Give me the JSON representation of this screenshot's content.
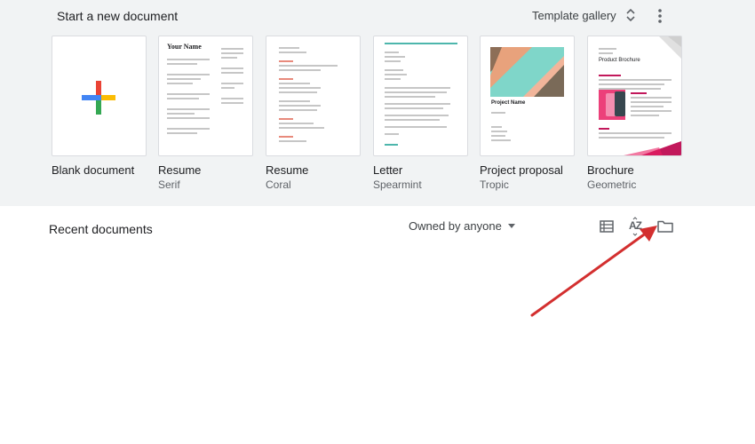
{
  "templates": {
    "section_title": "Start a new document",
    "gallery_label": "Template gallery",
    "items": [
      {
        "name": "Blank document",
        "sub": ""
      },
      {
        "name": "Resume",
        "sub": "Serif",
        "preview_heading": "Your Name"
      },
      {
        "name": "Resume",
        "sub": "Coral"
      },
      {
        "name": "Letter",
        "sub": "Spearmint"
      },
      {
        "name": "Project proposal",
        "sub": "Tropic",
        "preview_heading": "Project Name"
      },
      {
        "name": "Brochure",
        "sub": "Geometric",
        "preview_heading": "Product Brochure"
      }
    ]
  },
  "recent": {
    "title": "Recent documents",
    "owner_filter": "Owned by anyone",
    "sort_label": "AZ"
  },
  "colors": {
    "top_bg": "#f1f3f4",
    "annotation_arrow": "#d32f2f",
    "plus_blue": "#4285f4",
    "plus_red": "#ea4335",
    "plus_yellow": "#fbbc04",
    "plus_green": "#34a853"
  },
  "icons": [
    "unfold-more-icon",
    "more-vert-icon",
    "list-view-icon",
    "sort-az-icon",
    "folder-icon",
    "caret-down-icon",
    "plus-icon"
  ]
}
